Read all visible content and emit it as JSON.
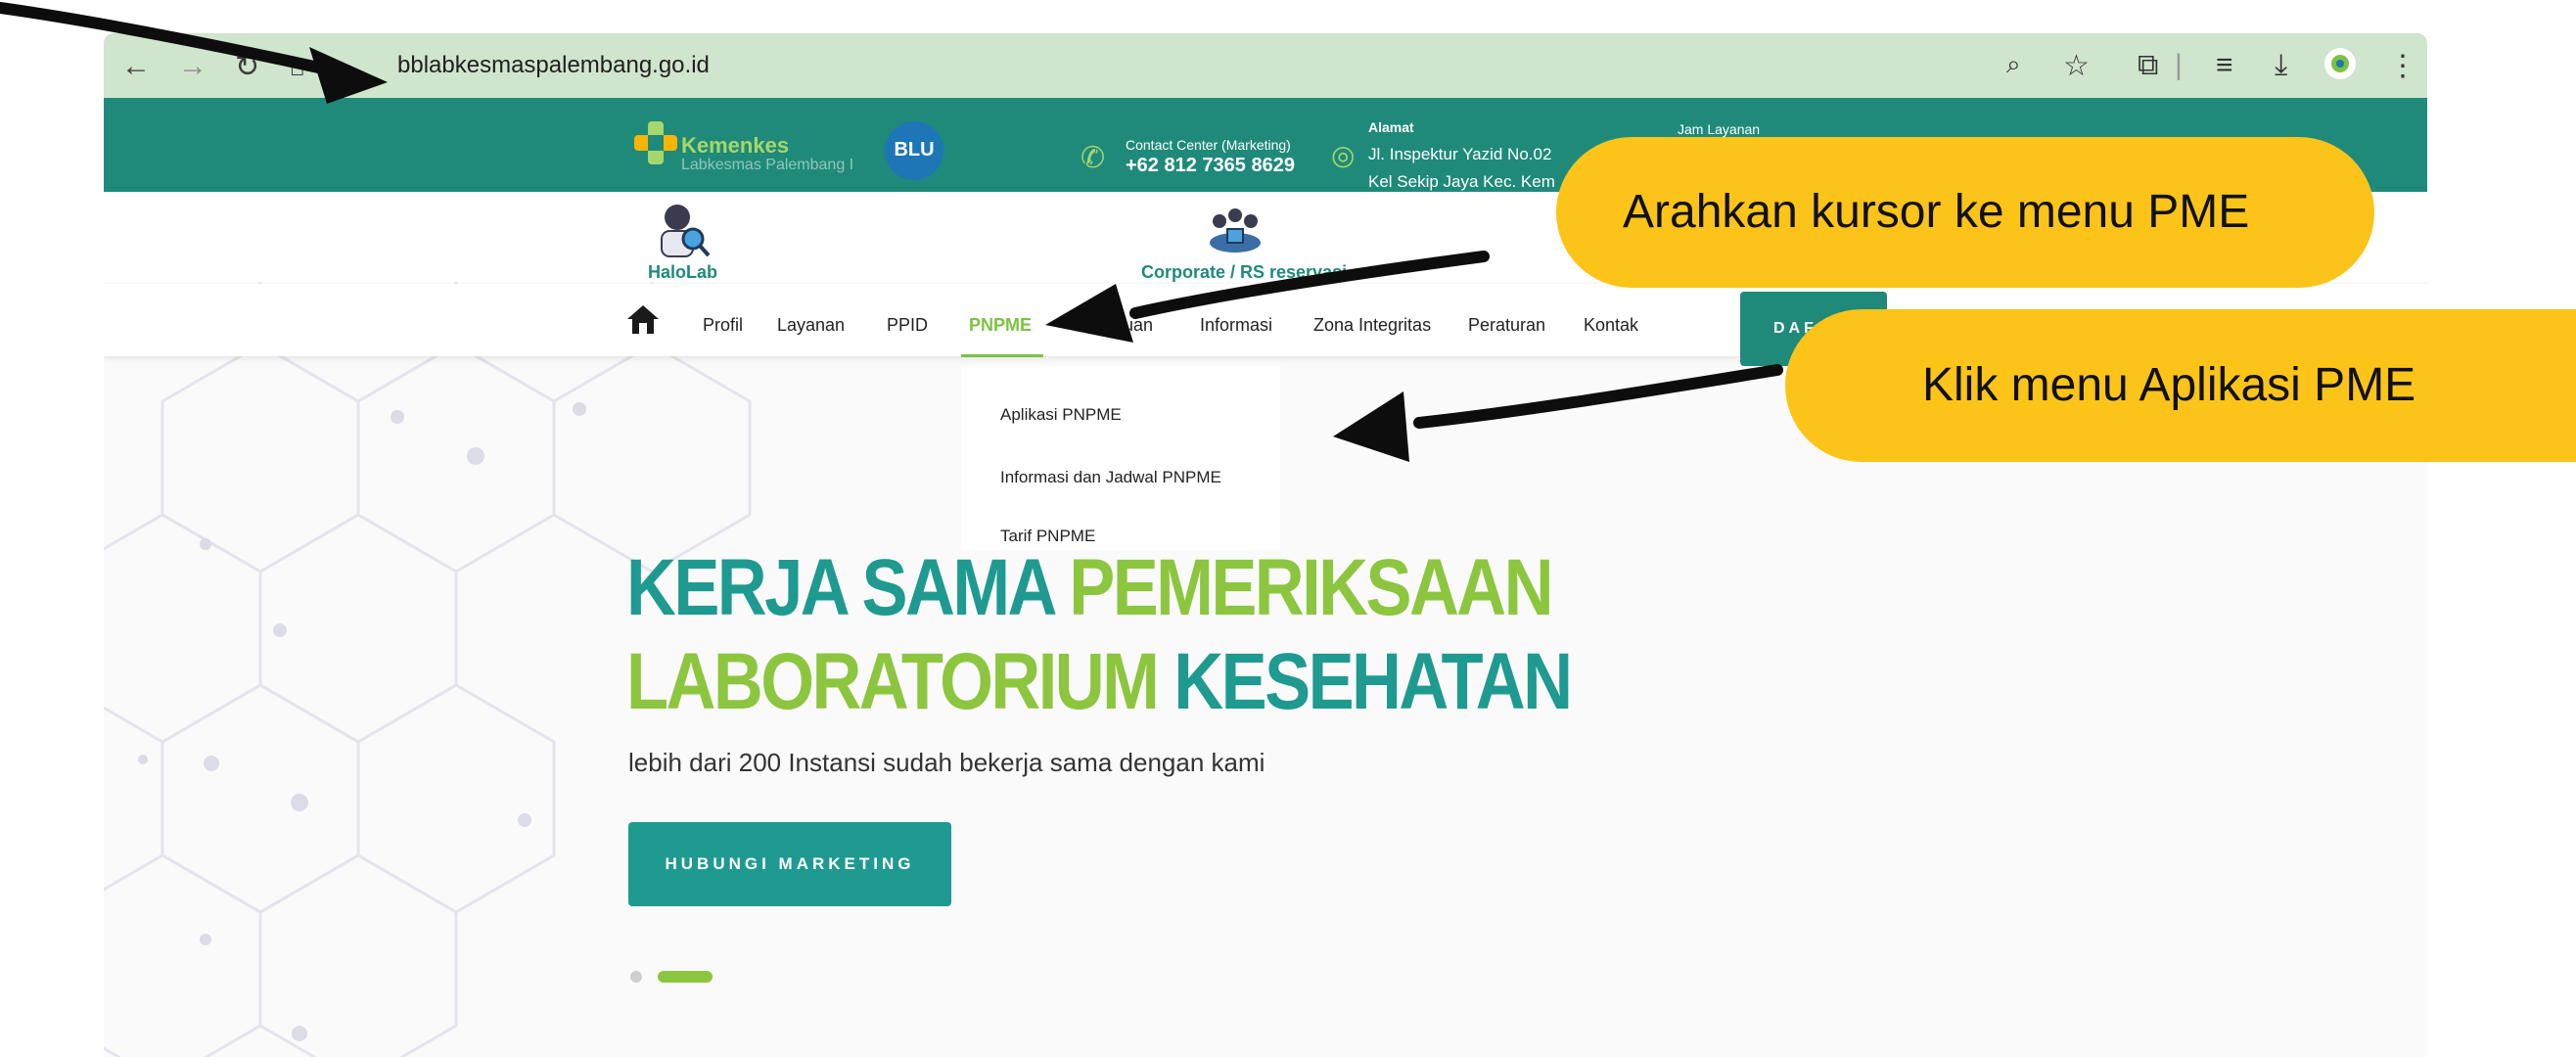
{
  "browser": {
    "url": "bblabkesmaspalembang.go.id",
    "nav_icons": [
      "back-arrow-icon",
      "forward-arrow-icon",
      "reload-icon",
      "home-icon"
    ],
    "toolbar_icons": [
      "zoom-icon",
      "bookmark-star-icon",
      "extensions-icon",
      "reading-list-icon",
      "download-icon",
      "profile-icon",
      "menu-kebab-icon"
    ]
  },
  "topbar": {
    "logo_title": "Kemenkes",
    "logo_sub": "Labkesmas Palembang I",
    "badge": "BLU",
    "contact_label": "Contact Center (Marketing)",
    "contact_phone": "+62 812 7365 8629",
    "address_label": "Alamat",
    "address_line1": "Jl. Inspektur Yazid No.02",
    "address_line2": "Kel Sekip Jaya Kec. Kem",
    "hours_label": "Jam Layanan"
  },
  "quicklinks": {
    "halolab": "HaloLab",
    "corporate": "Corporate / RS reservasi"
  },
  "nav": {
    "items": [
      "Profil",
      "Layanan",
      "PPID",
      "PNPME",
      "Panduan",
      "Informasi",
      "Zona Integritas",
      "Peraturan",
      "Kontak"
    ],
    "active": "PNPME",
    "daftar": "DAF"
  },
  "dropdown": {
    "items": [
      "Aplikasi PNPME",
      "Informasi dan Jadwal PNPME",
      "Tarif PNPME"
    ]
  },
  "hero": {
    "line1_part1": "KERJA SAMA ",
    "line1_part2": "PEMERIKSAAN",
    "line2_part1": "LABORATORIUM ",
    "line2_part2": "KESEHATAN",
    "subtitle": "lebih dari 200 Instansi sudah bekerja sama dengan kami",
    "button": "HUBUNGI MARKETING"
  },
  "callouts": {
    "first": "Arahkan kursor ke menu PME",
    "second": "Klik menu Aplikasi PME"
  },
  "colors": {
    "teal": "#1f8a7a",
    "green": "#8cc63f",
    "callout": "#fcc419",
    "chrome": "#cfe5cd"
  }
}
